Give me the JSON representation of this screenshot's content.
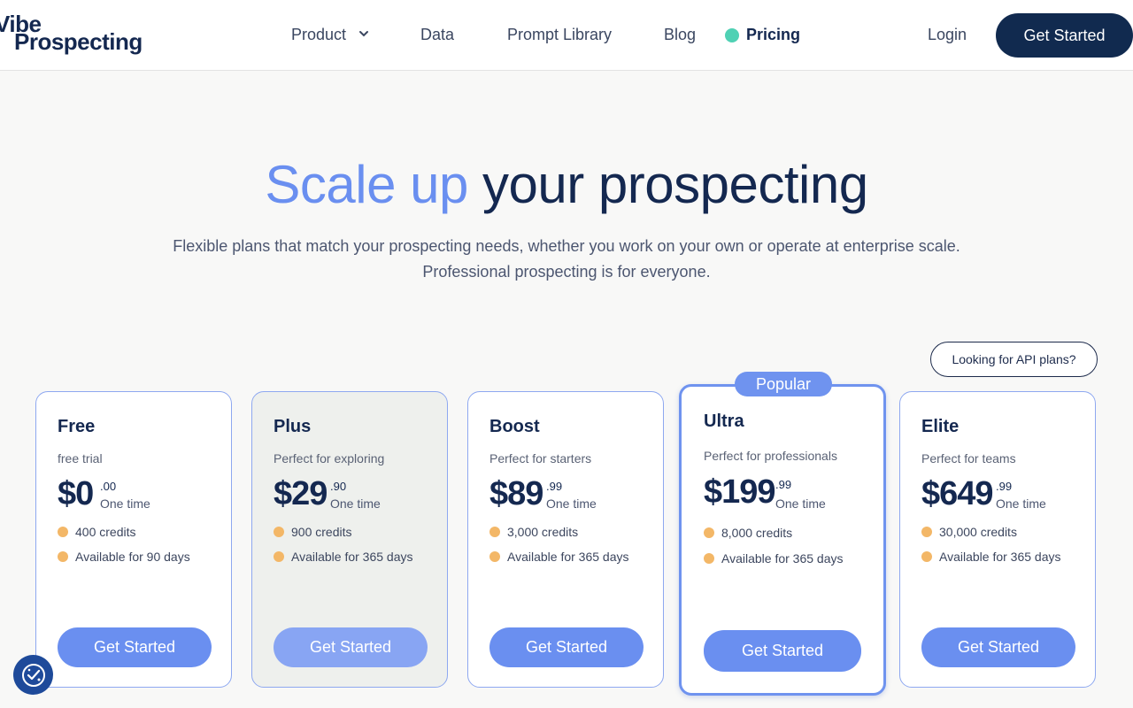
{
  "header": {
    "logo_line1": "Vibe",
    "logo_line2": "Prospecting",
    "nav": {
      "product": "Product",
      "data": "Data",
      "prompt_library": "Prompt Library",
      "blog": "Blog",
      "pricing": "Pricing"
    },
    "login": "Login",
    "get_started": "Get Started"
  },
  "hero": {
    "title_accent": "Scale up",
    "title_rest": "your prospecting",
    "subtitle": "Flexible plans that match your prospecting needs, whether you work on your own or operate at enterprise scale. Professional prospecting is for everyone."
  },
  "api_button": "Looking for API plans?",
  "popular_badge": "Popular",
  "plans": [
    {
      "name": "Free",
      "desc": "free trial",
      "price": "$0",
      "cents": ".00",
      "period": "One time",
      "credits": "400 credits",
      "availability": "Available for 90 days",
      "button": "Get Started"
    },
    {
      "name": "Plus",
      "desc": "Perfect for exploring",
      "price": "$29",
      "cents": ".90",
      "period": "One time",
      "credits": "900 credits",
      "availability": "Available for 365 days",
      "button": "Get Started"
    },
    {
      "name": "Boost",
      "desc": "Perfect for starters",
      "price": "$89",
      "cents": ".99",
      "period": "One time",
      "credits": "3,000 credits",
      "availability": "Available for 365 days",
      "button": "Get Started"
    },
    {
      "name": "Ultra",
      "desc": "Perfect for professionals",
      "price": "$199",
      "cents": ".99",
      "period": "One time",
      "credits": "8,000 credits",
      "availability": "Available for 365 days",
      "button": "Get Started"
    },
    {
      "name": "Elite",
      "desc": "Perfect for teams",
      "price": "$649",
      "cents": ".99",
      "period": "One time",
      "credits": "30,000 credits",
      "availability": "Available for 365 days",
      "button": "Get Started"
    }
  ],
  "colors": {
    "navy": "#142850",
    "accent_blue": "#6a8ff0",
    "pricing_dot": "#4fd1b4",
    "feature_dot": "#f3b767"
  },
  "icons": {
    "product_menu": "chevron-down-icon",
    "cookie_settings": "cookie-consent-icon"
  }
}
